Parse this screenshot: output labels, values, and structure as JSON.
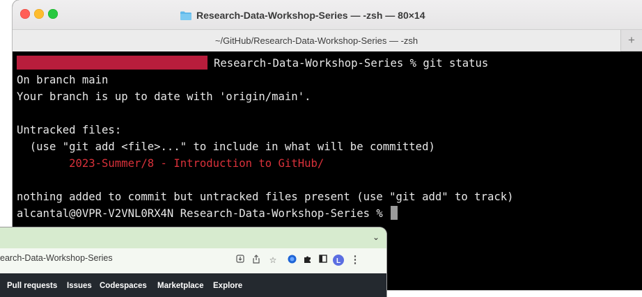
{
  "terminal": {
    "window_title": "Research-Data-Workshop-Series — -zsh — 80×14",
    "tab_title": "~/GitHub/Research-Data-Workshop-Series — -zsh",
    "new_tab_label": "+",
    "lines": {
      "prompt_cmd": "Research-Data-Workshop-Series % git status",
      "branch": "On branch main",
      "uptodate": "Your branch is up to date with 'origin/main'.",
      "untracked_header": "Untracked files:",
      "hint": "  (use \"git add <file>...\" to include in what will be committed)",
      "untracked_file": "        2023-Summer/8 - Introduction to GitHub/",
      "nothing_added": "nothing added to commit but untracked files present (use \"git add\" to track)",
      "prompt2": "alcantal@0VPR-V2VNL0RX4N Research-Data-Workshop-Series % "
    },
    "colors": {
      "redaction": "#b81d3c",
      "untracked": "#d9313a",
      "background": "#000000"
    }
  },
  "browser": {
    "tab_chevron": "⌄",
    "url_text": "earch-Data-Workshop-Series",
    "toolbar_icons": [
      "install-icon",
      "share-icon",
      "bookmark-star-icon",
      "extension-blue-icon",
      "puzzle-icon",
      "sidebar-icon",
      "profile-icon",
      "menu-icon"
    ],
    "profile_letter": "L",
    "menu_glyph": "⋮",
    "nav": {
      "pull_requests": "Pull requests",
      "issues": "Issues",
      "codespaces": "Codespaces",
      "marketplace": "Marketplace",
      "explore": "Explore"
    }
  }
}
